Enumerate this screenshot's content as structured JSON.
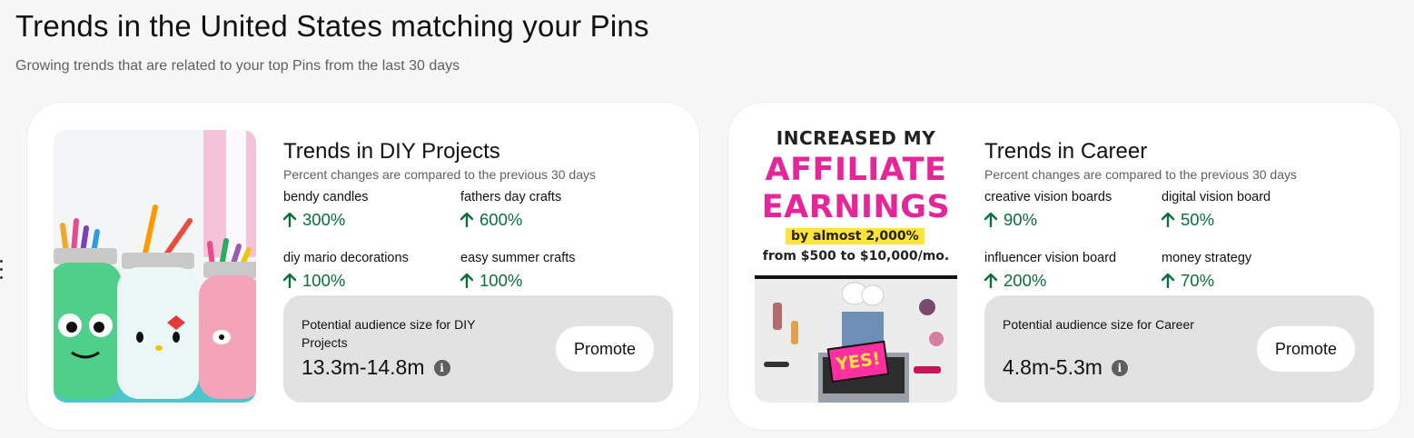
{
  "header": {
    "title": "Trends in the United States matching your Pins",
    "subtitle": "Growing trends that are related to your top Pins from the last 30 days"
  },
  "colors": {
    "positive": "#0b6e3a",
    "card_bg": "#ffffff",
    "audience_bg": "#e2e2e2",
    "accent_pink": "#e6259a"
  },
  "cards": [
    {
      "title": "Trends in DIY Projects",
      "note": "Percent changes are compared to the previous 30 days",
      "trends": [
        {
          "label": "bendy candles",
          "change": "300%"
        },
        {
          "label": "fathers day crafts",
          "change": "600%"
        },
        {
          "label": "diy mario decorations",
          "change": "100%"
        },
        {
          "label": "easy summer crafts",
          "change": "100%"
        }
      ],
      "audience": {
        "label": "Potential audience size for DIY Projects",
        "value": "13.3m-14.8m",
        "button": "Promote"
      }
    },
    {
      "title": "Trends in Career",
      "note": "Percent changes are compared to the previous 30 days",
      "thumbnail_text": {
        "line1": "INCREASED MY",
        "line2": "AFFILIATE",
        "line3": "EARNINGS",
        "line4": "by almost 2,000%",
        "line5": "from $500 to $10,000/mo.",
        "badge": "YES!"
      },
      "trends": [
        {
          "label": "creative vision boards",
          "change": "90%"
        },
        {
          "label": "digital vision board",
          "change": "50%"
        },
        {
          "label": "influencer vision board",
          "change": "200%"
        },
        {
          "label": "money strategy",
          "change": "70%"
        }
      ],
      "audience": {
        "label": "Potential audience size for Career",
        "value": "4.8m-5.3m",
        "button": "Promote"
      }
    }
  ]
}
